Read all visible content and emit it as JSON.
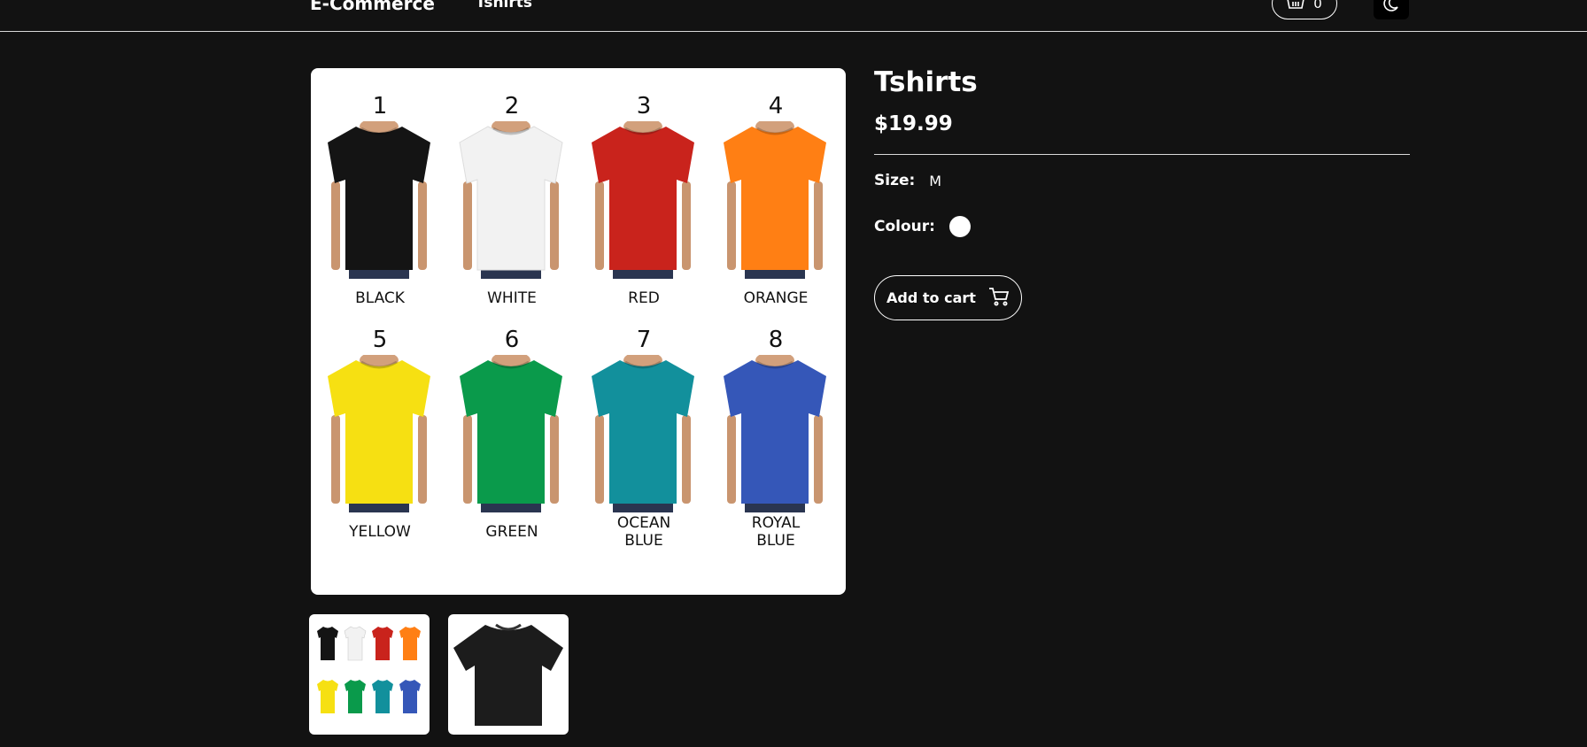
{
  "nav": {
    "brand": "E-Commerce",
    "link": "Tshirts",
    "cart_count": "0",
    "icons": {
      "cart": "basket-icon",
      "theme": "moon-icon"
    }
  },
  "product": {
    "title": "Tshirts",
    "price": "$19.99",
    "size_label": "Size:",
    "size_value": "M",
    "colour_label": "Colour:",
    "selected_colour": "#ffffff",
    "add_to_cart": "Add to cart"
  },
  "gallery": {
    "shirts": [
      {
        "num": "1",
        "name": "BLACK",
        "color": "#141414"
      },
      {
        "num": "2",
        "name": "WHITE",
        "color": "#f2f2f2"
      },
      {
        "num": "3",
        "name": "RED",
        "color": "#c9231c"
      },
      {
        "num": "4",
        "name": "ORANGE",
        "color": "#ff7f14"
      },
      {
        "num": "5",
        "name": "YELLOW",
        "color": "#f6e012"
      },
      {
        "num": "6",
        "name": "GREEN",
        "color": "#0a9a4b"
      },
      {
        "num": "7",
        "name": "OCEAN\nBLUE",
        "color": "#12909c"
      },
      {
        "num": "8",
        "name": "ROYAL\nBLUE",
        "color": "#3557b8"
      }
    ],
    "thumb_count": 2
  }
}
